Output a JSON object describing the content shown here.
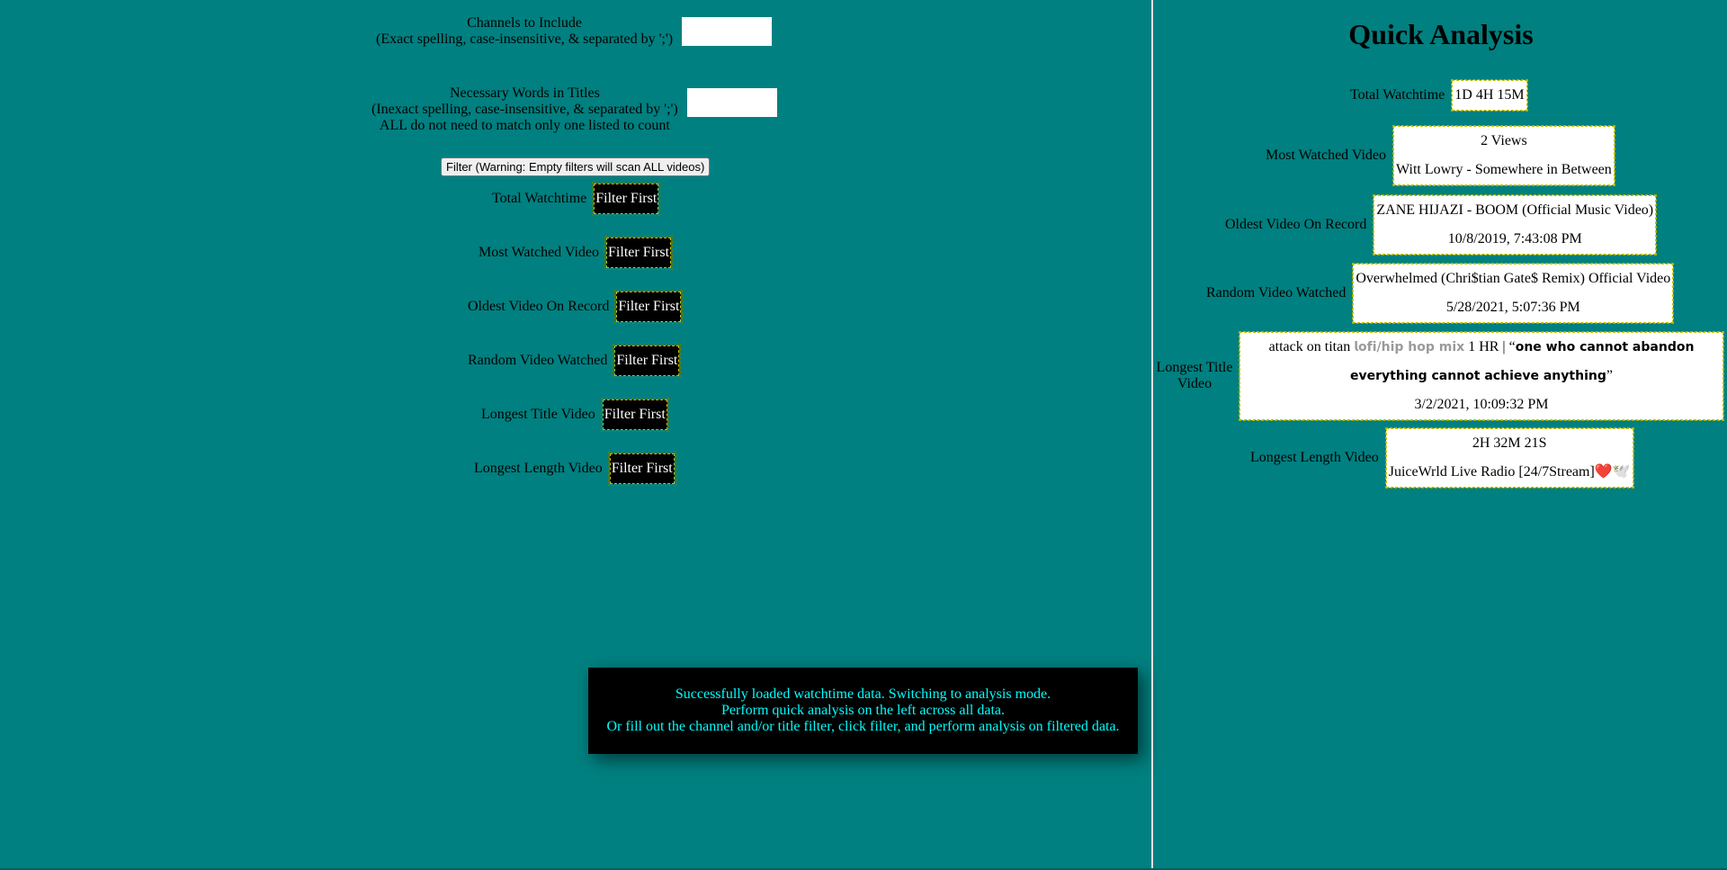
{
  "filters": {
    "channels_label_line1": "Channels to Include",
    "channels_label_line2": "(Exact spelling, case-insensitive, & separated by ';')",
    "channels_value": "",
    "words_label_line1": "Necessary Words in Titles",
    "words_label_line2": "(Inexact spelling, case-insensitive, & separated by ';')",
    "words_label_line3": "ALL do not need to match only one listed to count",
    "words_value": "",
    "filter_button": "Filter (Warning: Empty filters will scan ALL videos)"
  },
  "left_stats": [
    {
      "label": "Total Watchtime",
      "button": "Filter First"
    },
    {
      "label": "Most Watched Video",
      "button": "Filter First"
    },
    {
      "label": "Oldest Video On Record",
      "button": "Filter First"
    },
    {
      "label": "Random Video Watched",
      "button": "Filter First"
    },
    {
      "label": "Longest Title Video",
      "button": "Filter First"
    },
    {
      "label": "Longest Length Video",
      "button": "Filter First"
    }
  ],
  "quick_analysis": {
    "title": "Quick Analysis",
    "total_watchtime": {
      "label": "Total Watchtime",
      "value": "1D 4H 15M"
    },
    "most_watched": {
      "label": "Most Watched Video",
      "views": "2 Views",
      "title": "Witt Lowry - Somewhere in Between"
    },
    "oldest": {
      "label": "Oldest Video On Record",
      "title": "ZANE HIJAZI - BOOM (Official Music Video)",
      "date": "10/8/2019, 7:43:08 PM"
    },
    "random": {
      "label": "Random Video Watched",
      "title": "Overwhelmed (Chri$tian Gate$ Remix) Official Video",
      "date": "5/28/2021, 5:07:36 PM"
    },
    "longest_title": {
      "label_line1": "Longest Title",
      "label_line2": "Video",
      "title_part1": "attack on titan ",
      "title_part2": "𝗹𝗼𝗳𝗶/𝗵𝗶𝗽 𝗵𝗼𝗽 𝗺𝗶𝘅",
      "title_part3": " 1 HR | “",
      "title_part4": "𝗼𝗻𝗲 𝘄𝗵𝗼 𝗰𝗮𝗻𝗻𝗼𝘁 𝗮𝗯𝗮𝗻𝗱𝗼𝗻 𝗲𝘃𝗲𝗿𝘆𝘁𝗵𝗶𝗻𝗴 𝗰𝗮𝗻𝗻𝗼𝘁 𝗮𝗰𝗵𝗶𝗲𝘃𝗲 𝗮𝗻𝘆𝘁𝗵𝗶𝗻𝗴",
      "title_part5": "”",
      "date": "3/2/2021, 10:09:32 PM"
    },
    "longest_length": {
      "label": "Longest Length Video",
      "duration": "2H 32M 21S",
      "title": "JuiceWrld Live Radio [24/7Stream]",
      "emoji": "❤️🕊️"
    }
  },
  "toast": {
    "line1": "Successfully loaded watchtime data. Switching to analysis mode.",
    "line2": "Perform quick analysis on the left across all data.",
    "line3": "Or fill out the channel and/or title filter, click filter, and perform analysis on filtered data."
  },
  "colors": {
    "background": "#008080",
    "toast_text": "#00ffff",
    "button_dark": "#000000"
  }
}
